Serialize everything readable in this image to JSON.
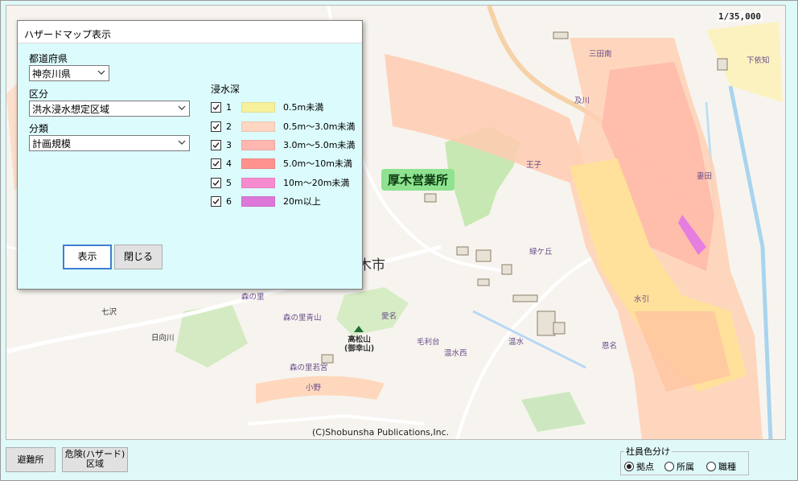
{
  "map": {
    "scale": "1/35,000",
    "copyright": "(C)Shobunsha Publications,Inc.",
    "office_label": "厚木営業所",
    "city_label_partial": "木市",
    "place_labels": [
      {
        "text": "三田南"
      },
      {
        "text": "下依知"
      },
      {
        "text": "及川"
      },
      {
        "text": "王子"
      },
      {
        "text": "妻田"
      },
      {
        "text": "緑ケ丘"
      },
      {
        "text": "森の里"
      },
      {
        "text": "七沢"
      },
      {
        "text": "森の里青山"
      },
      {
        "text": "愛名"
      },
      {
        "text": "日向川"
      },
      {
        "text": "毛利台"
      },
      {
        "text": "温水"
      },
      {
        "text": "温水西"
      },
      {
        "text": "恩名"
      },
      {
        "text": "森の里若宮"
      },
      {
        "text": "小野"
      },
      {
        "text": "水引"
      }
    ],
    "mountain_label": "高松山\n(御幸山)"
  },
  "dialog": {
    "title": "ハザードマップ表示",
    "prefecture_label": "都道府県",
    "prefecture_value": "神奈川県",
    "category_label": "区分",
    "category_value": "洪水浸水想定区域",
    "class_label": "分類",
    "class_value": "計画規模",
    "legend_title": "浸水深",
    "legend": [
      {
        "num": "1",
        "text": "0.5m未満",
        "color": "#f7f19b",
        "checked": true
      },
      {
        "num": "2",
        "text": "0.5m～3.0m未満",
        "color": "#ffd6c1",
        "checked": true
      },
      {
        "num": "3",
        "text": "3.0m～5.0m未満",
        "color": "#ffb7b0",
        "checked": true
      },
      {
        "num": "4",
        "text": "5.0m～10m未満",
        "color": "#ff918e",
        "checked": true
      },
      {
        "num": "5",
        "text": "10m～20m未満",
        "color": "#f78bd0",
        "checked": true
      },
      {
        "num": "6",
        "text": "20m以上",
        "color": "#dd78d8",
        "checked": true
      }
    ],
    "show_button": "表示",
    "close_button": "閉じる"
  },
  "bottom": {
    "shelter_button": "避難所",
    "hazard_button_line1": "危険(ハザード)",
    "hazard_button_line2": "区域",
    "color_group_title": "社員色分け",
    "radios": [
      {
        "label": "拠点",
        "selected": true
      },
      {
        "label": "所属",
        "selected": false
      },
      {
        "label": "職種",
        "selected": false
      }
    ]
  }
}
